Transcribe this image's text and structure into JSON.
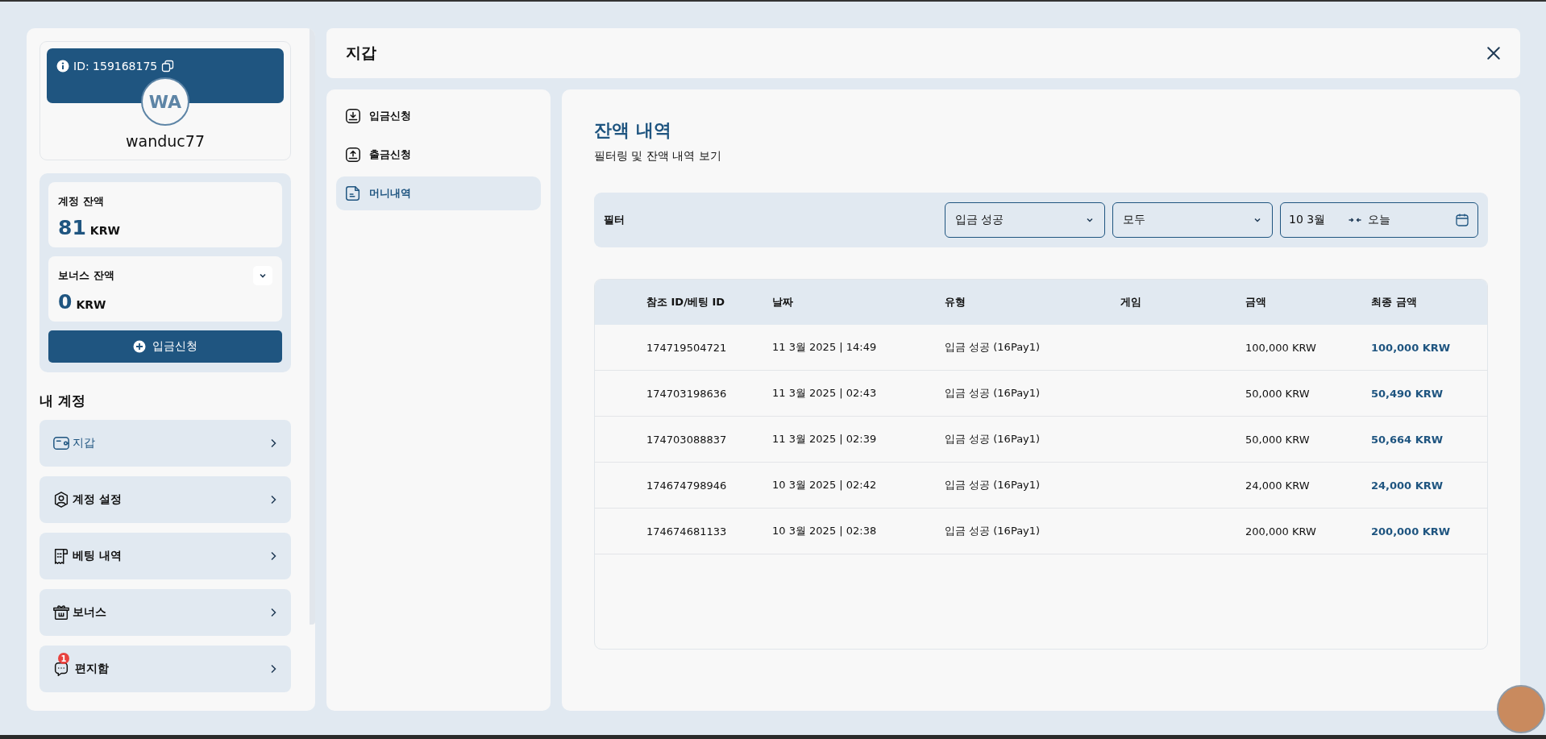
{
  "profile": {
    "id_label": "ID: 159168175",
    "initials": "WA",
    "username": "wanduc77"
  },
  "balances": [
    {
      "kind": "plain",
      "label": "계정 잔액",
      "amount": "81",
      "currency": "KRW"
    },
    {
      "kind": "collapsible",
      "label": "보너스 잔액",
      "amount": "0",
      "currency": "KRW",
      "expanded": false
    }
  ],
  "deposit_button": "입금신청",
  "account_menu": {
    "heading": "내 계정",
    "items": [
      {
        "label": "지갑",
        "selected": true
      },
      {
        "label": "계정 설정",
        "selected": false
      },
      {
        "label": "베팅 내역",
        "selected": false
      },
      {
        "label": "보너스",
        "selected": false
      },
      {
        "label": "편지함",
        "selected": false,
        "badge": "1"
      }
    ]
  },
  "window": {
    "title": "지갑"
  },
  "wallet_nav": [
    {
      "label": "입금신청",
      "selected": false
    },
    {
      "label": "출금신청",
      "selected": false
    },
    {
      "label": "머니내역",
      "selected": true
    }
  ],
  "history": {
    "title": "잔액 내역",
    "subtitle": "필터링 및 잔액 내역 보기",
    "filter": {
      "label": "필터",
      "selects": [
        {
          "value": "입금 성공"
        },
        {
          "value": "모두"
        }
      ],
      "date_range": {
        "from": "10 3월",
        "to": "오늘"
      }
    },
    "table": {
      "columns": [
        "참조 ID/베팅 ID",
        "날짜",
        "유형",
        "게임",
        "금액",
        "최종 금액"
      ],
      "rows": [
        {
          "ref": "174719504721",
          "date": "11 3월 2025 | 14:49",
          "type": "입금 성공 (16Pay1)",
          "amount": "100,000 KRW",
          "final": "100,000 KRW"
        },
        {
          "ref": "174703198636",
          "date": "11 3월 2025 | 02:43",
          "type": "입금 성공 (16Pay1)",
          "amount": "50,000 KRW",
          "final": "50,490 KRW"
        },
        {
          "ref": "174703088837",
          "date": "11 3월 2025 | 02:39",
          "type": "입금 성공 (16Pay1)",
          "amount": "50,000 KRW",
          "final": "50,664 KRW"
        },
        {
          "ref": "174674798946",
          "date": "10 3월 2025 | 02:42",
          "type": "입금 성공 (16Pay1)",
          "amount": "24,000 KRW",
          "final": "24,000 KRW"
        },
        {
          "ref": "174674681133",
          "date": "10 3월 2025 | 02:38",
          "type": "입금 성공 (16Pay1)",
          "amount": "200,000 KRW",
          "final": "200,000 KRW"
        }
      ]
    }
  }
}
